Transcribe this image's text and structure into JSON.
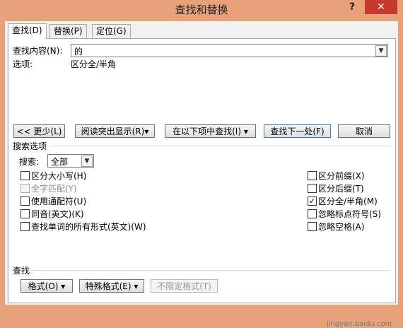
{
  "window": {
    "title": "查找和替换",
    "help_glyph": "?",
    "close_glyph": "✕"
  },
  "tabs": [
    {
      "label": "查找(D)",
      "active": true
    },
    {
      "label": "替换(P)",
      "active": false
    },
    {
      "label": "定位(G)",
      "active": false
    }
  ],
  "find": {
    "label": "查找内容(N):",
    "value": "的",
    "options_label": "选项:",
    "options_value": "区分全/半角"
  },
  "buttons": {
    "less": "<< 更少(L)",
    "reading_highlight": "阅读突出显示(R)▾",
    "find_in": "在以下项中查找(I) ▾",
    "find_next": "查找下一处(F)",
    "cancel": "取消"
  },
  "search_options": {
    "section_label": "搜索选项",
    "search_label": "搜索:",
    "search_value": "全部",
    "left": [
      {
        "label": "区分大小写(H)",
        "checked": false,
        "disabled": false
      },
      {
        "label": "全字匹配(Y)",
        "checked": false,
        "disabled": true
      },
      {
        "label": "使用通配符(U)",
        "checked": false,
        "disabled": false
      },
      {
        "label": "同音(英文)(K)",
        "checked": false,
        "disabled": false
      },
      {
        "label": "查找单词的所有形式(英文)(W)",
        "checked": false,
        "disabled": false
      }
    ],
    "right": [
      {
        "label": "区分前缀(X)",
        "checked": false,
        "disabled": false
      },
      {
        "label": "区分后缀(T)",
        "checked": false,
        "disabled": false
      },
      {
        "label": "区分全/半角(M)",
        "checked": true,
        "disabled": false
      },
      {
        "label": "忽略标点符号(S)",
        "checked": false,
        "disabled": false
      },
      {
        "label": "忽略空格(A)",
        "checked": false,
        "disabled": false
      }
    ]
  },
  "find_section": {
    "label": "查找",
    "format": "格式(O) ▾",
    "special": "特殊格式(E) ▾",
    "no_format": "不限定格式(T)"
  },
  "watermark": "jingyan.baidu.com",
  "check_glyph": "✓"
}
